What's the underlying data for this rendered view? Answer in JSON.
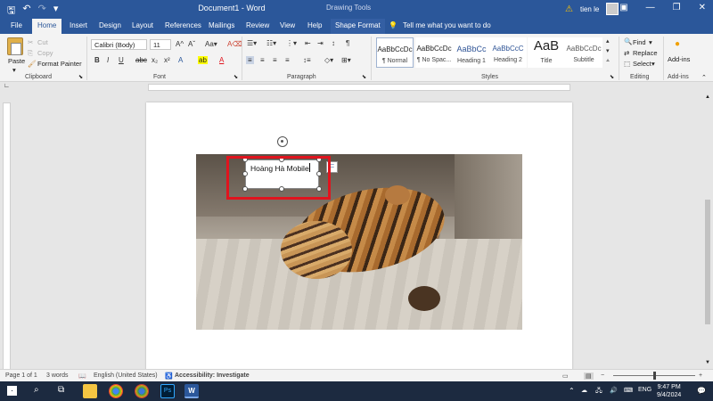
{
  "title_bar": {
    "document_title": "Document1 - Word",
    "contextual_label": "Drawing Tools",
    "user_name": "tien le",
    "quick_access": [
      "save-icon",
      "undo-icon",
      "redo-icon",
      "customize-icon"
    ]
  },
  "tabs": [
    "File",
    "Home",
    "Insert",
    "Design",
    "Layout",
    "References",
    "Mailings",
    "Review",
    "View",
    "Help",
    "Shape Format"
  ],
  "active_tab": "Home",
  "tell_me": "Tell me what you want to do",
  "clipboard": {
    "paste": "Paste",
    "cut": "Cut",
    "copy": "Copy",
    "format_painter": "Format Painter",
    "label": "Clipboard"
  },
  "font": {
    "name": "Calibri (Body)",
    "size": "11",
    "label": "Font",
    "buttons": [
      "B",
      "I",
      "U",
      "abc",
      "x₂",
      "x²",
      "A",
      "A"
    ]
  },
  "paragraph": {
    "label": "Paragraph"
  },
  "styles": {
    "label": "Styles",
    "items": [
      {
        "preview": "AaBbCcDc",
        "name": "¶ Normal"
      },
      {
        "preview": "AaBbCcDc",
        "name": "¶ No Spac..."
      },
      {
        "preview": "AaBbCc",
        "name": "Heading 1"
      },
      {
        "preview": "AaBbCcC",
        "name": "Heading 2"
      },
      {
        "preview": "AaB",
        "name": "Title"
      },
      {
        "preview": "AaBbCcDc",
        "name": "Subtitle"
      }
    ]
  },
  "editing": {
    "find": "Find",
    "replace": "Replace",
    "select": "Select",
    "label": "Editing"
  },
  "addins": {
    "button": "Add-ins",
    "label": "Add-ins"
  },
  "document": {
    "textbox_text": "Hoàng Hà Mobile"
  },
  "status_bar": {
    "page": "Page 1 of 1",
    "words": "3 words",
    "language": "English (United States)",
    "accessibility": "Accessibility: Investigate"
  },
  "taskbar": {
    "language": "ENG",
    "time": "9:47 PM",
    "date": "9/4/2024"
  }
}
